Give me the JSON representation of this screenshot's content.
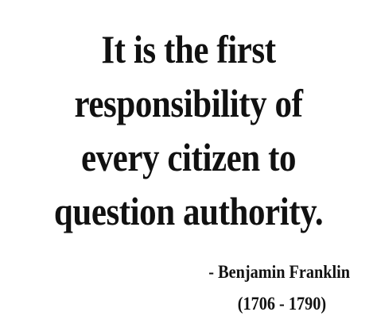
{
  "quote": {
    "lines": [
      "It is the first",
      "responsibility of",
      "every citizen to",
      "question authority."
    ]
  },
  "attribution": {
    "author": "- Benjamin Franklin",
    "years": "(1706 - 1790)"
  }
}
